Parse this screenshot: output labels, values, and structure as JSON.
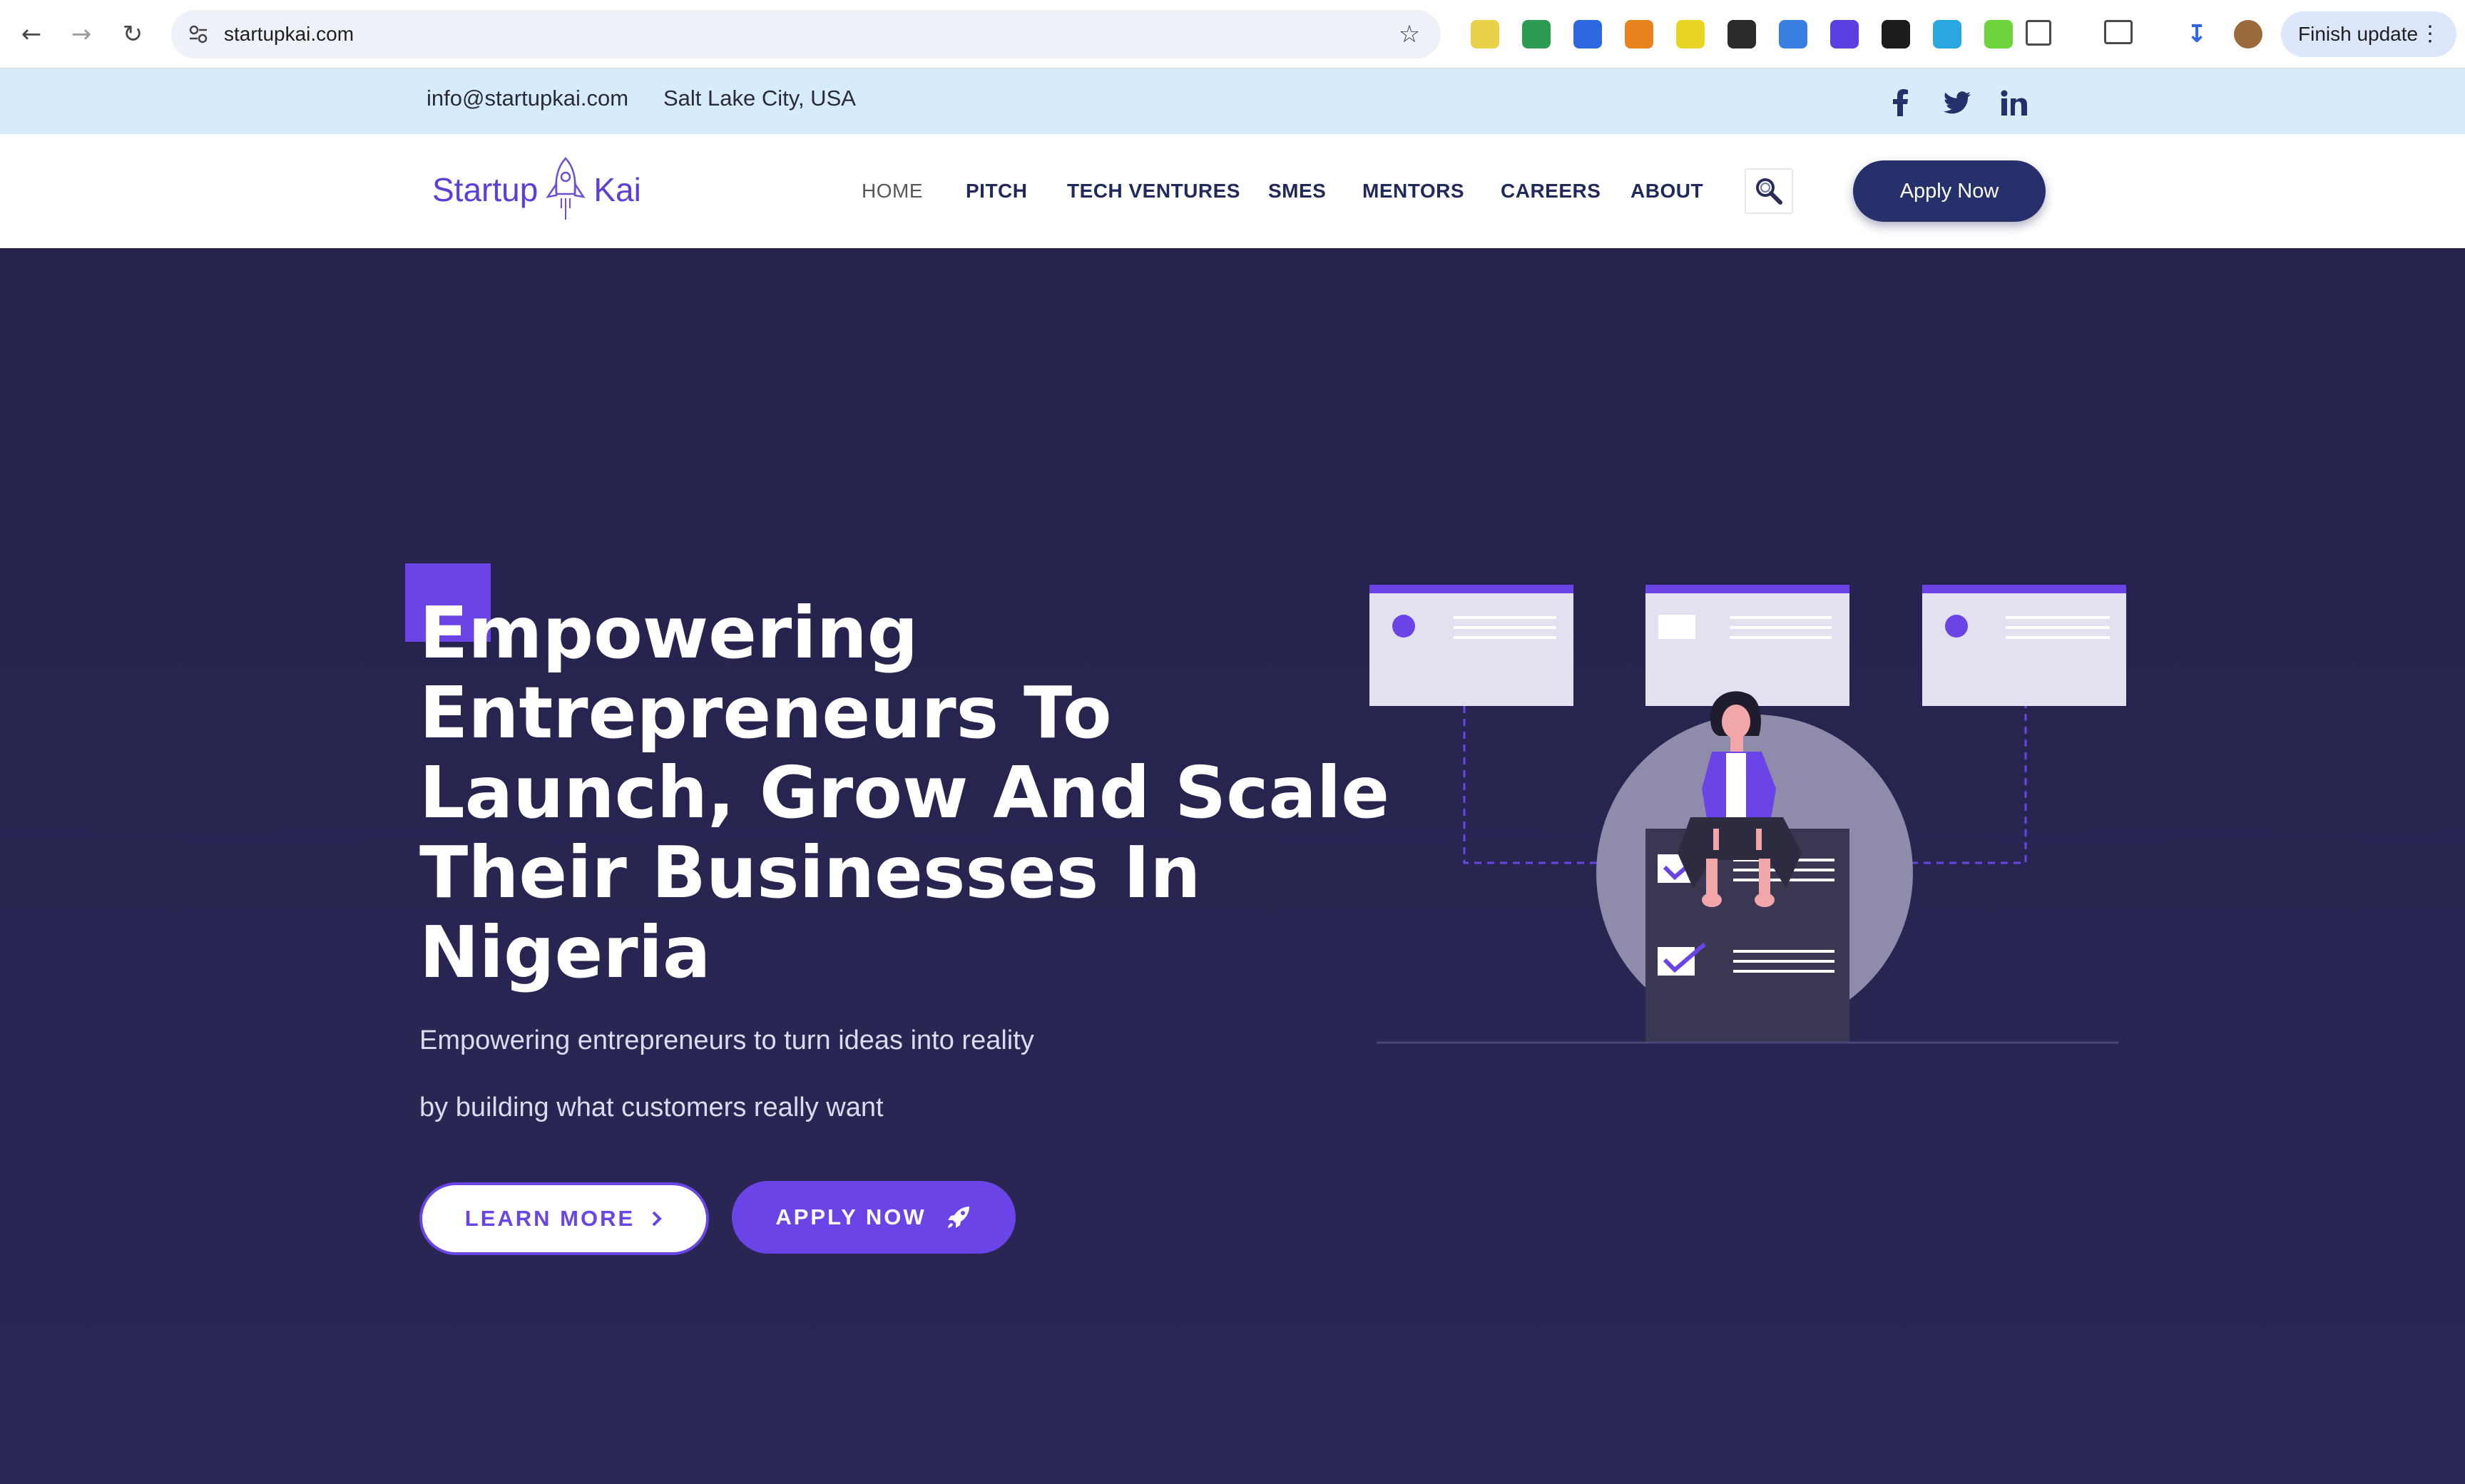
{
  "browser": {
    "url": "startupkai.com",
    "finish_update_label": "Finish update",
    "extensions": [
      {
        "name": "pen-extension-icon",
        "color": "#e9d24a"
      },
      {
        "name": "green-circle-extension-icon",
        "color": "#2e9b52"
      },
      {
        "name": "blue-ring-extension-icon",
        "color": "#2f67e0"
      },
      {
        "name": "metamask-extension-icon",
        "color": "#e8821e"
      },
      {
        "name": "s-extension-icon",
        "color": "#e9d524"
      },
      {
        "name": "box-extension-icon",
        "color": "#2b2b2b"
      },
      {
        "name": "fi-extension-icon",
        "color": "#3a7fe0"
      },
      {
        "name": "purple-extension-icon",
        "color": "#5b3fe0"
      },
      {
        "name": "black-s-extension-icon",
        "color": "#1c1c1c"
      },
      {
        "name": "download-teal-extension-icon",
        "color": "#2aa7e0"
      },
      {
        "name": "green-grid-extension-icon",
        "color": "#6fd43b"
      }
    ]
  },
  "topbar": {
    "email": "info@startupkai.com",
    "location": "Salt Lake City, USA"
  },
  "nav": {
    "logo_left": "Startup",
    "logo_right": "Kai",
    "items": [
      "HOME",
      "PITCH",
      "TECH VENTURES",
      "SMES",
      "MENTORS",
      "CAREERS",
      "ABOUT"
    ],
    "apply_label": "Apply Now"
  },
  "hero": {
    "headline_lines": [
      "Empowering",
      "Entrepreneurs To",
      "Launch, Grow And Scale",
      "Their Businesses In",
      "Nigeria"
    ],
    "sub_line_1": "Empowering entrepreneurs to turn ideas into reality",
    "sub_line_2": "by building what customers really want",
    "learn_more_label": "LEARN MORE",
    "apply_now_label": "APPLY NOW"
  },
  "colors": {
    "accent": "#6a44e6",
    "navy": "#26306b",
    "hero_bg": "#26244d",
    "topbar_bg": "#d6ecfb"
  }
}
